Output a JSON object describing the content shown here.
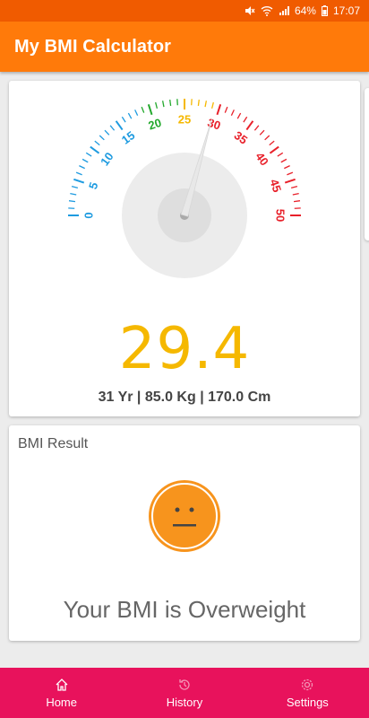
{
  "status_bar": {
    "battery": "64%",
    "time": "17:07"
  },
  "app_bar": {
    "title": "My BMI Calculator"
  },
  "gauge": {
    "min": 0,
    "max": 50,
    "value": 29.4,
    "major_labels": [
      "0",
      "5",
      "10",
      "15",
      "20",
      "25",
      "30",
      "35",
      "40",
      "45",
      "50"
    ],
    "colors": {
      "underweight": "#1e9be0",
      "normal": "#22a82c",
      "overweight": "#f5b800",
      "obese": "#e8202a"
    }
  },
  "bmi": {
    "value_text": "29.4",
    "stats": "31 Yr | 85.0 Kg | 170.0 Cm"
  },
  "result": {
    "title": "BMI Result",
    "message": "Your BMI is Overweight",
    "face_color": "#f7941d"
  },
  "bottom_nav": {
    "items": [
      {
        "label": "Home",
        "icon": "home-icon"
      },
      {
        "label": "History",
        "icon": "history-icon"
      },
      {
        "label": "Settings",
        "icon": "settings-icon"
      }
    ],
    "color": "#e8125c"
  }
}
